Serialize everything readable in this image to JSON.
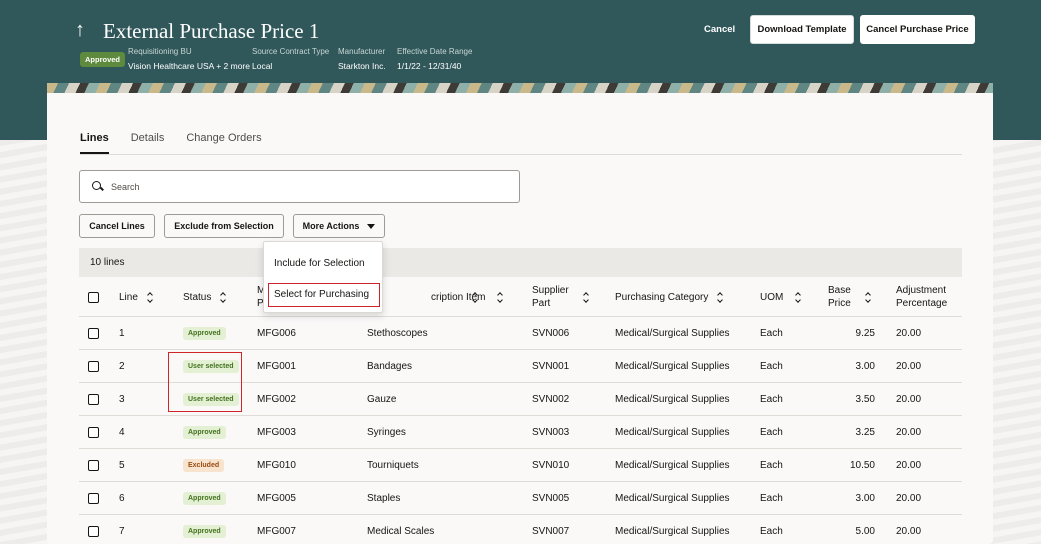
{
  "header": {
    "title": "External Purchase Price 1",
    "status_badge": "Approved",
    "meta": [
      {
        "label": "Requisitioning BU",
        "value": "Vision Healthcare USA + 2 more"
      },
      {
        "label": "Source Contract Type",
        "value": "Local"
      },
      {
        "label": "Manufacturer",
        "value": "Starkton Inc."
      },
      {
        "label": "Effective Date Range",
        "value": "1/1/22 - 12/31/40"
      }
    ],
    "cancel_label": "Cancel",
    "download_label": "Download Template",
    "cancel_pp_label": "Cancel Purchase Price",
    "colors": {
      "header_bg": "#30575a",
      "badge_bg": "#5d8a3d"
    }
  },
  "tabs": [
    "Lines",
    "Details",
    "Change Orders"
  ],
  "search": {
    "placeholder": "Search"
  },
  "toolbar": {
    "cancel_lines": "Cancel Lines",
    "exclude": "Exclude from Selection",
    "more_actions": "More Actions"
  },
  "dropdown": {
    "items": [
      "Include for Selection",
      "Select for Purchasing"
    ]
  },
  "table": {
    "count": "10 lines",
    "headers": {
      "line": "Line",
      "status": "Status",
      "mfg_part": "M\nP",
      "description": "cription",
      "item": "Item",
      "supplier_part": "Supplier Part",
      "category": "Purchasing Category",
      "uom": "UOM",
      "base_price": "Base Price",
      "adjustment": "Adjustment Percentage"
    },
    "rows": [
      {
        "line": "1",
        "status": "Approved",
        "status_type": "approved",
        "mfg": "MFG006",
        "desc": "Stethoscopes",
        "supplier": "SVN006",
        "category": "Medical/Surgical Supplies",
        "uom": "Each",
        "price": "9.25",
        "adj": "20.00"
      },
      {
        "line": "2",
        "status": "User selected",
        "status_type": "user",
        "mfg": "MFG001",
        "desc": "Bandages",
        "supplier": "SVN001",
        "category": "Medical/Surgical Supplies",
        "uom": "Each",
        "price": "3.00",
        "adj": "20.00"
      },
      {
        "line": "3",
        "status": "User selected",
        "status_type": "user",
        "mfg": "MFG002",
        "desc": "Gauze",
        "supplier": "SVN002",
        "category": "Medical/Surgical Supplies",
        "uom": "Each",
        "price": "3.50",
        "adj": "20.00"
      },
      {
        "line": "4",
        "status": "Approved",
        "status_type": "approved",
        "mfg": "MFG003",
        "desc": "Syringes",
        "supplier": "SVN003",
        "category": "Medical/Surgical Supplies",
        "uom": "Each",
        "price": "3.25",
        "adj": "20.00"
      },
      {
        "line": "5",
        "status": "Excluded",
        "status_type": "excluded",
        "mfg": "MFG010",
        "desc": "Tourniquets",
        "supplier": "SVN010",
        "category": "Medical/Surgical Supplies",
        "uom": "Each",
        "price": "10.50",
        "adj": "20.00"
      },
      {
        "line": "6",
        "status": "Approved",
        "status_type": "approved",
        "mfg": "MFG005",
        "desc": "Staples",
        "supplier": "SVN005",
        "category": "Medical/Surgical Supplies",
        "uom": "Each",
        "price": "3.00",
        "adj": "20.00"
      },
      {
        "line": "7",
        "status": "Approved",
        "status_type": "approved",
        "mfg": "MFG007",
        "desc": "Medical Scales",
        "supplier": "SVN007",
        "category": "Medical/Surgical Supplies",
        "uom": "Each",
        "price": "5.00",
        "adj": "20.00"
      }
    ]
  }
}
